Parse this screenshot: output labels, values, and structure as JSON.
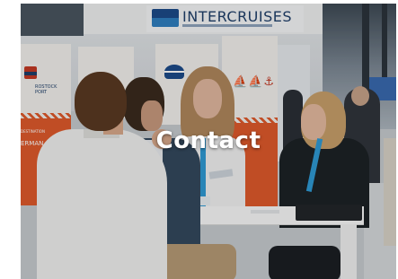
{
  "hero": {
    "title": "Contact",
    "banner_text": "INTERCRUISES",
    "booth_label_a_line1": "ROSTOCK",
    "booth_label_a_line2": "PORT",
    "orange_text_a_small": "DESTINATION",
    "orange_text_a_large": "ERMAN",
    "brand_color": "#1f3f6a",
    "accent_orange": "#e05a2c",
    "lanyard_blue": "#2f9bd6"
  }
}
